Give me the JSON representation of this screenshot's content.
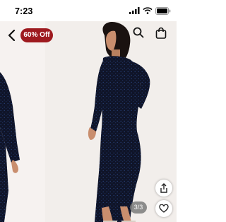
{
  "status_bar": {
    "time": "7:23"
  },
  "header": {
    "discount_badge": "60% Off"
  },
  "gallery": {
    "counter": "3/3"
  },
  "icons": {
    "back": "back-arrow-icon",
    "search": "search-icon",
    "bag": "shopping-bag-icon",
    "share": "share-icon",
    "favorite": "heart-icon"
  },
  "colors": {
    "badge": "#9e1a1f",
    "dress": "#0f1428",
    "background": "#f3efec"
  }
}
